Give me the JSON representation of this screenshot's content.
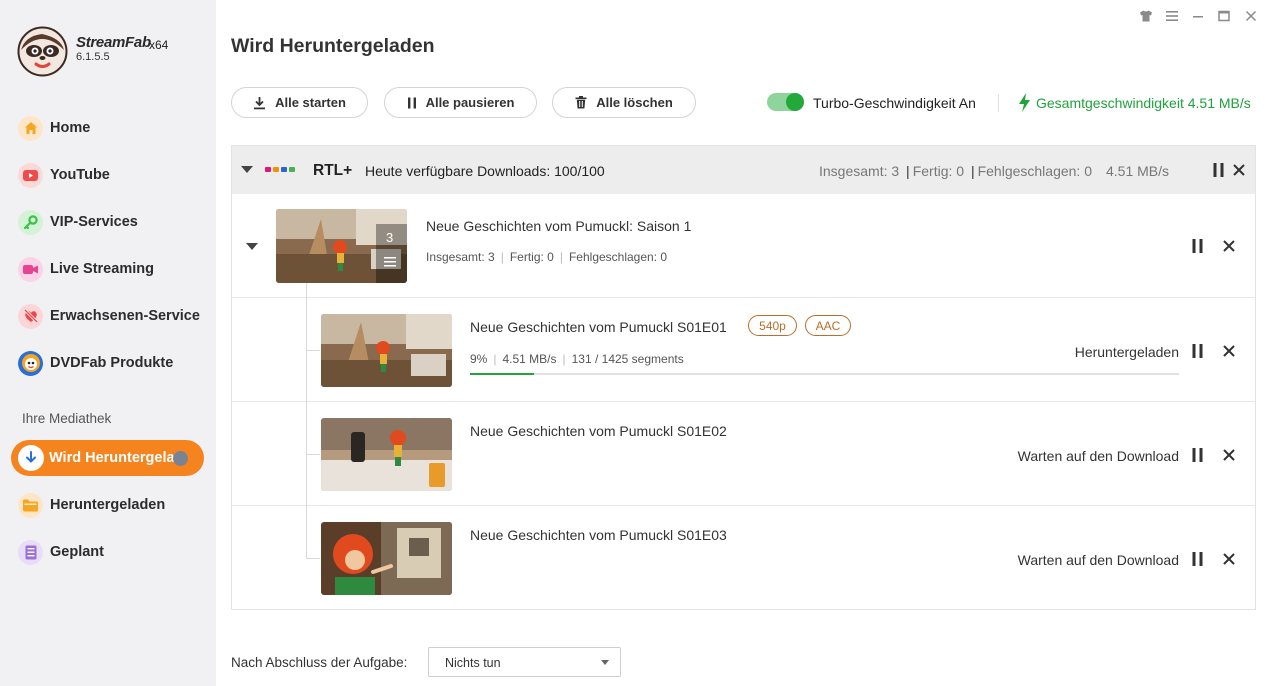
{
  "app": {
    "name": "StreamFab",
    "arch": "x64",
    "version": "6.1.5.5"
  },
  "sidebar": {
    "items": [
      {
        "label": "Home",
        "icon": "home-icon",
        "color": "#f5a623"
      },
      {
        "label": "YouTube",
        "icon": "youtube-icon",
        "color": "#f04a4a"
      },
      {
        "label": "VIP-Services",
        "icon": "key-icon",
        "color": "#3cc24a"
      },
      {
        "label": "Live Streaming",
        "icon": "video-camera-icon",
        "color": "#e84393"
      },
      {
        "label": "Erwachsenen-Services",
        "icon": "adult-icon",
        "color": "#f0464a"
      },
      {
        "label": "DVDFab Produkte",
        "icon": "dvdfab-icon",
        "color": "#2b6fd6"
      }
    ],
    "library_heading": "Ihre Mediathek",
    "library": [
      {
        "label": "Wird Heruntergeladen",
        "icon": "download-icon",
        "active": true
      },
      {
        "label": "Heruntergeladen",
        "icon": "folder-icon",
        "color": "#f5a623"
      },
      {
        "label": "Geplant",
        "icon": "schedule-icon",
        "color": "#9b6fd6"
      }
    ]
  },
  "main": {
    "title": "Wird Heruntergeladen",
    "toolbar": {
      "start_all": "Alle starten",
      "pause_all": "Alle pausieren",
      "delete_all": "Alle löschen",
      "turbo_label": "Turbo-Geschwindigkeit An",
      "turbo_on": true,
      "total_speed": "Gesamtgeschwindigkeit 4.51 MB/s"
    },
    "group": {
      "service": "RTL+",
      "available": "Heute verfügbare Downloads: 100/100",
      "total": "Insgesamt: 3",
      "done": "Fertig: 0",
      "failed": "Fehlgeschlagen: 0",
      "speed": "4.51 MB/s"
    },
    "season": {
      "title": "Neue Geschichten vom Pumuckl: Saison 1",
      "count_badge": "3",
      "total": "Insgesamt:  3",
      "done": "Fertig:  0",
      "failed": "Fehlgeschlagen:  0"
    },
    "episodes": [
      {
        "title": "Neue Geschichten vom Pumuckl S01E01",
        "tags": [
          "540p",
          "AAC"
        ],
        "percent": "9%",
        "progress": 0.09,
        "speed": "4.51 MB/s",
        "segments": "131 / 1425 segments",
        "status": "Heruntergeladen"
      },
      {
        "title": "Neue Geschichten vom Pumuckl S01E02",
        "status": "Warten auf den Download"
      },
      {
        "title": "Neue Geschichten vom Pumuckl S01E03",
        "status": "Warten auf den Download"
      }
    ]
  },
  "footer": {
    "after_task_label": "Nach Abschluss der Aufgabe:",
    "after_task_value": "Nichts tun"
  },
  "colors": {
    "accent": "#f5841f",
    "success": "#22a53a",
    "tag": "#b7702b"
  }
}
